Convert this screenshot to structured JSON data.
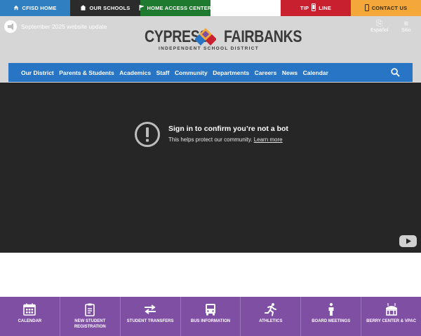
{
  "topbar": {
    "home": "CFISD HOME",
    "schools": "OUR SCHOOLS",
    "hac": "HOME ACCESS CENTER",
    "tip_left": "TIP",
    "tip_right": "LINE",
    "contact": "CONTACT US"
  },
  "header": {
    "alert_text": "September 2025 website update",
    "logo_left": "CYPRESS",
    "logo_right": "FAIRBANKS",
    "logo_sub": "INDEPENDENT SCHOOL DISTRICT",
    "translate_label": "Español",
    "menu_label": "Sitio"
  },
  "nav": {
    "items": [
      "Our District",
      "Parents & Students",
      "Academics",
      "Staff",
      "Community",
      "Departments",
      "Careers",
      "News",
      "Calendar"
    ]
  },
  "video": {
    "title": "Sign in to confirm you’re not a bot",
    "subtitle": "This helps protect our community.",
    "link": "Learn more"
  },
  "quick_links": [
    {
      "label": "CALENDAR"
    },
    {
      "label": "NEW STUDENT REGISTRATION"
    },
    {
      "label": "STUDENT TRANSFERS"
    },
    {
      "label": "BUS INFORMATION"
    },
    {
      "label": "ATHLETICS"
    },
    {
      "label": "BOARD MEETINGS"
    },
    {
      "label": "BERRY CENTER & VPAC"
    }
  ],
  "colors": {
    "home": "#2f7fc1",
    "schools": "#2b2b2b",
    "hac": "#1e7a2e",
    "tip": "#c8202f",
    "contact": "#f4a83a",
    "nav": "#2874c5",
    "quick": "#7e4fa3"
  }
}
